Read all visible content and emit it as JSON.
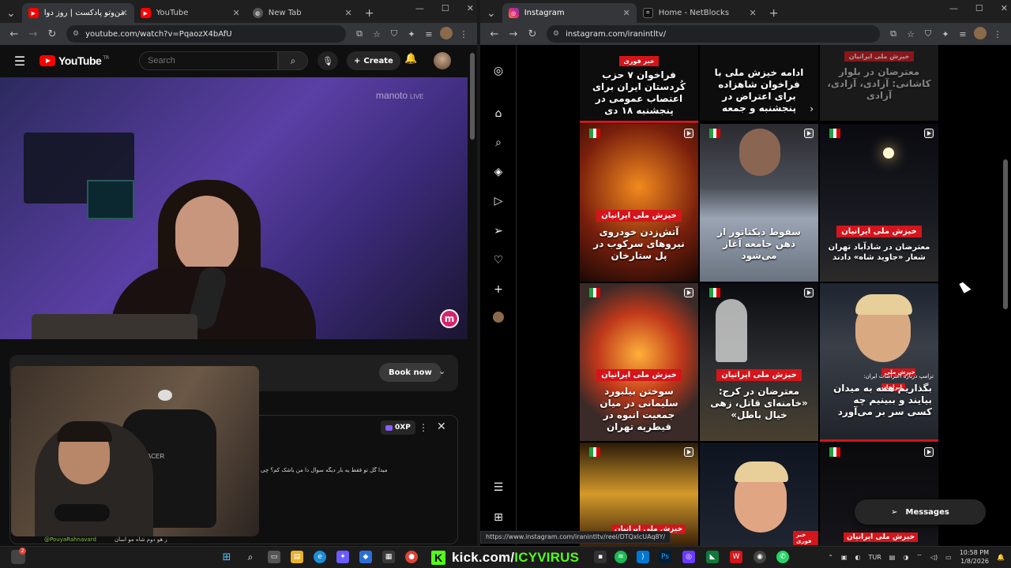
{
  "left_window": {
    "tabs": [
      {
        "title": "من‌وتو پادکست | روز دوا",
        "icon": "youtube-icon",
        "active": true
      },
      {
        "title": "YouTube",
        "icon": "youtube-icon",
        "active": false
      },
      {
        "title": "New Tab",
        "icon": "globe-icon",
        "active": false
      }
    ],
    "url": "youtube.com/watch?v=PqaozX4bAfU"
  },
  "youtube": {
    "logo_text": "YouTube",
    "logo_suffix": "TR",
    "search_placeholder": "Search",
    "create_label": "Create",
    "watermark": "manoto",
    "watermark_live": "LIVE",
    "badge_letter": "m",
    "book_now": "Book now",
    "xp_label": "0XP",
    "chat_line": "میدا گل تو فقط یه بار دیگه سوال دا من باشک کم؟ چی",
    "chat_user": "@PouyaRahnavard",
    "chat_message": "ر هو دوم شاه مو اسان",
    "cam_chair_text": "DXRACER"
  },
  "right_window": {
    "tabs": [
      {
        "title": "Instagram",
        "icon": "instagram-icon",
        "active": true
      },
      {
        "title": "Home - NetBlocks",
        "icon": "netblocks-icon",
        "active": false
      }
    ],
    "url": "instagram.com/iranintltv/",
    "status_url": "https://www.instagram.com/iranintltv/reel/DTQxlcUAq8Y/"
  },
  "instagram": {
    "top_row": [
      {
        "tag": "خبر فوری",
        "text": "فراخوان ۷ حزب کُردستان ایران برای اعتصاب عمومی در پنجشنبه ۱۸ دی"
      },
      {
        "tag": "",
        "text": "ادامه خیزش ملی با فراخوان شاهزاده برای اعتراض در پنجشنبه و جمعه"
      },
      {
        "tag": "خیزش ملی ایرانیان",
        "text": "معترضان در بلوار کاشانی: آزادی، آزادی، آزادی"
      }
    ],
    "row2": [
      {
        "tag": "خیزش ملی ایرانیان",
        "text": "آتش‌زدن خودروی نیروهای سرکوب در پل ستارخان"
      },
      {
        "tag": "",
        "text": "سقوط دیکتاتور از ذهن جامعه آغاز می‌شود"
      },
      {
        "tag": "خیزش ملی ایرانیان",
        "text": "معترضان در شادآباد تهران شعار «جاوید شاه» دادند"
      }
    ],
    "row3": [
      {
        "tag": "خیزش ملی ایرانیان",
        "text": "سوختن بیلبورد سلیمانی در میان جمعیت انبوه در قیطریه تهران"
      },
      {
        "tag": "خیزش ملی ایرانیان",
        "text": "معترضان در کرج: «خامنه‌ای قاتل، زهی خیال باطل»"
      },
      {
        "tag": "خیزش ملی ایرانیان",
        "sub": "ترامپ درباره اعتراضات ایران:",
        "text": "بگذاریم همه به میدان بیایند و ببینیم چه کسی سر بر می‌آورد"
      }
    ],
    "row4": [
      {
        "tag": "خیزش ملی ایرانیان",
        "text": ""
      },
      {
        "tag": "خبر فوری",
        "text": ""
      },
      {
        "tag": "خیزش ملی ایرانیان",
        "text": ""
      }
    ],
    "messages_label": "Messages"
  },
  "taskbar": {
    "badge_count": "2",
    "kick_prefix": "kick.com/",
    "kick_name": "ICYVIRUS",
    "language": "TUR",
    "time": "10:58 PM",
    "date": "1/8/2026"
  },
  "colors": {
    "accent_red": "#d4151b",
    "kick_green": "#53fc18",
    "yt_red": "#ff0000"
  }
}
